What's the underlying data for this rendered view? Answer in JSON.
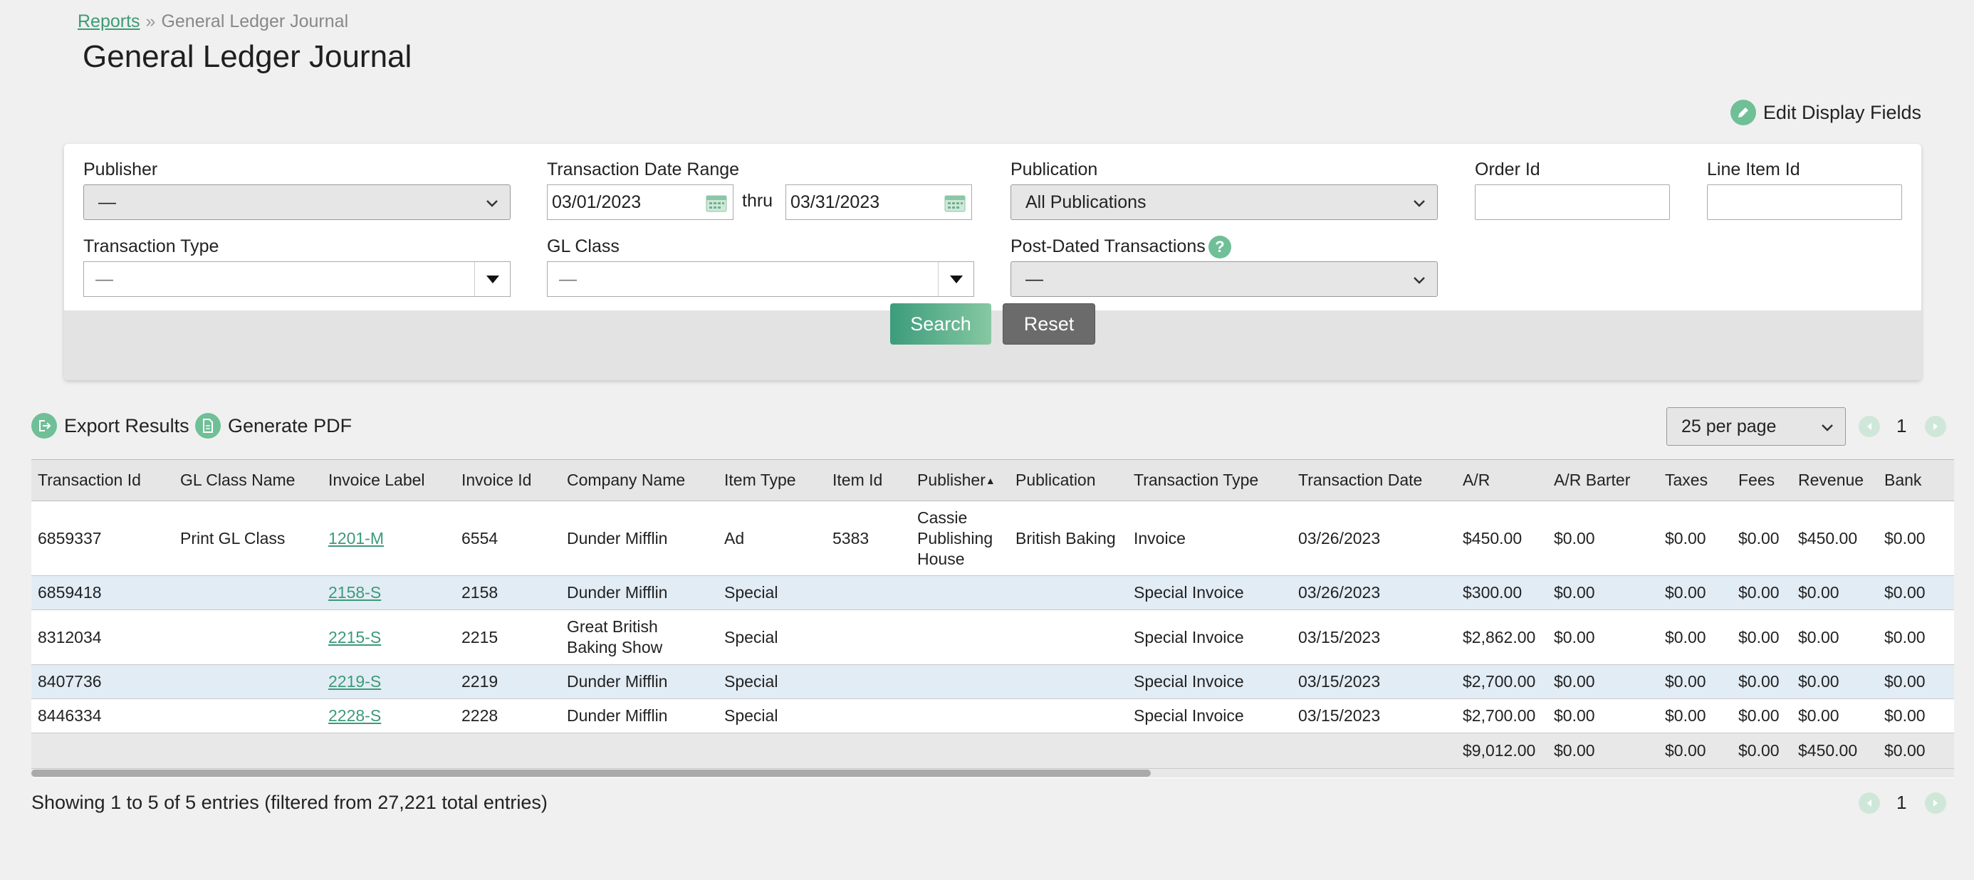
{
  "breadcrumb": {
    "root": "Reports",
    "separator": "»",
    "current": "General Ledger Journal"
  },
  "page_title": "General Ledger Journal",
  "edit_display_fields": "Edit Display Fields",
  "filters": {
    "publisher": {
      "label": "Publisher",
      "value": "—"
    },
    "date_range": {
      "label": "Transaction Date Range",
      "from": "03/01/2023",
      "thru": "thru",
      "to": "03/31/2023"
    },
    "publication": {
      "label": "Publication",
      "value": "All Publications"
    },
    "order_id": {
      "label": "Order Id",
      "value": ""
    },
    "line_item_id": {
      "label": "Line Item Id",
      "value": ""
    },
    "transaction_type": {
      "label": "Transaction Type",
      "value": "—"
    },
    "gl_class": {
      "label": "GL Class",
      "value": "—"
    },
    "post_dated": {
      "label": "Post-Dated Transactions",
      "value": "—",
      "help": "?"
    },
    "search_label": "Search",
    "reset_label": "Reset"
  },
  "toolbar": {
    "export": "Export Results",
    "pdf": "Generate PDF",
    "per_page": "25 per page",
    "page": "1"
  },
  "table": {
    "columns": [
      "Transaction Id",
      "GL Class Name",
      "Invoice Label",
      "Invoice Id",
      "Company Name",
      "Item Type",
      "Item Id",
      "Publisher",
      "Publication",
      "Transaction Type",
      "Transaction Date",
      "A/R",
      "A/R Barter",
      "Taxes",
      "Fees",
      "Revenue",
      "Bank"
    ],
    "sorted_column": "Publisher",
    "sort_caret": "▲",
    "rows": [
      [
        "6859337",
        "Print GL Class",
        "1201-M",
        "6554",
        "Dunder Mifflin",
        "Ad",
        "5383",
        "Cassie Publishing House",
        "British Baking",
        "Invoice",
        "03/26/2023",
        "$450.00",
        "$0.00",
        "$0.00",
        "$0.00",
        "$450.00",
        "$0.00"
      ],
      [
        "6859418",
        "",
        "2158-S",
        "2158",
        "Dunder Mifflin",
        "Special",
        "",
        "",
        "",
        "Special Invoice",
        "03/26/2023",
        "$300.00",
        "$0.00",
        "$0.00",
        "$0.00",
        "$0.00",
        "$0.00"
      ],
      [
        "8312034",
        "",
        "2215-S",
        "2215",
        "Great British Baking Show",
        "Special",
        "",
        "",
        "",
        "Special Invoice",
        "03/15/2023",
        "$2,862.00",
        "$0.00",
        "$0.00",
        "$0.00",
        "$0.00",
        "$0.00"
      ],
      [
        "8407736",
        "",
        "2219-S",
        "2219",
        "Dunder Mifflin",
        "Special",
        "",
        "",
        "",
        "Special Invoice",
        "03/15/2023",
        "$2,700.00",
        "$0.00",
        "$0.00",
        "$0.00",
        "$0.00",
        "$0.00"
      ],
      [
        "8446334",
        "",
        "2228-S",
        "2228",
        "Dunder Mifflin",
        "Special",
        "",
        "",
        "",
        "Special Invoice",
        "03/15/2023",
        "$2,700.00",
        "$0.00",
        "$0.00",
        "$0.00",
        "$0.00",
        "$0.00"
      ]
    ],
    "totals": [
      "",
      "",
      "",
      "",
      "",
      "",
      "",
      "",
      "",
      "",
      "",
      "$9,012.00",
      "$0.00",
      "$0.00",
      "$0.00",
      "$450.00",
      "$0.00"
    ]
  },
  "footer": {
    "showing": "Showing 1 to 5 of 5 entries (filtered from 27,221 total entries)",
    "page": "1"
  },
  "colors": {
    "accent": "#3d9a78",
    "icon_green": "#6fbf97",
    "row_alt": "#e2ecf5",
    "reset_gray": "#6b6b6b"
  }
}
